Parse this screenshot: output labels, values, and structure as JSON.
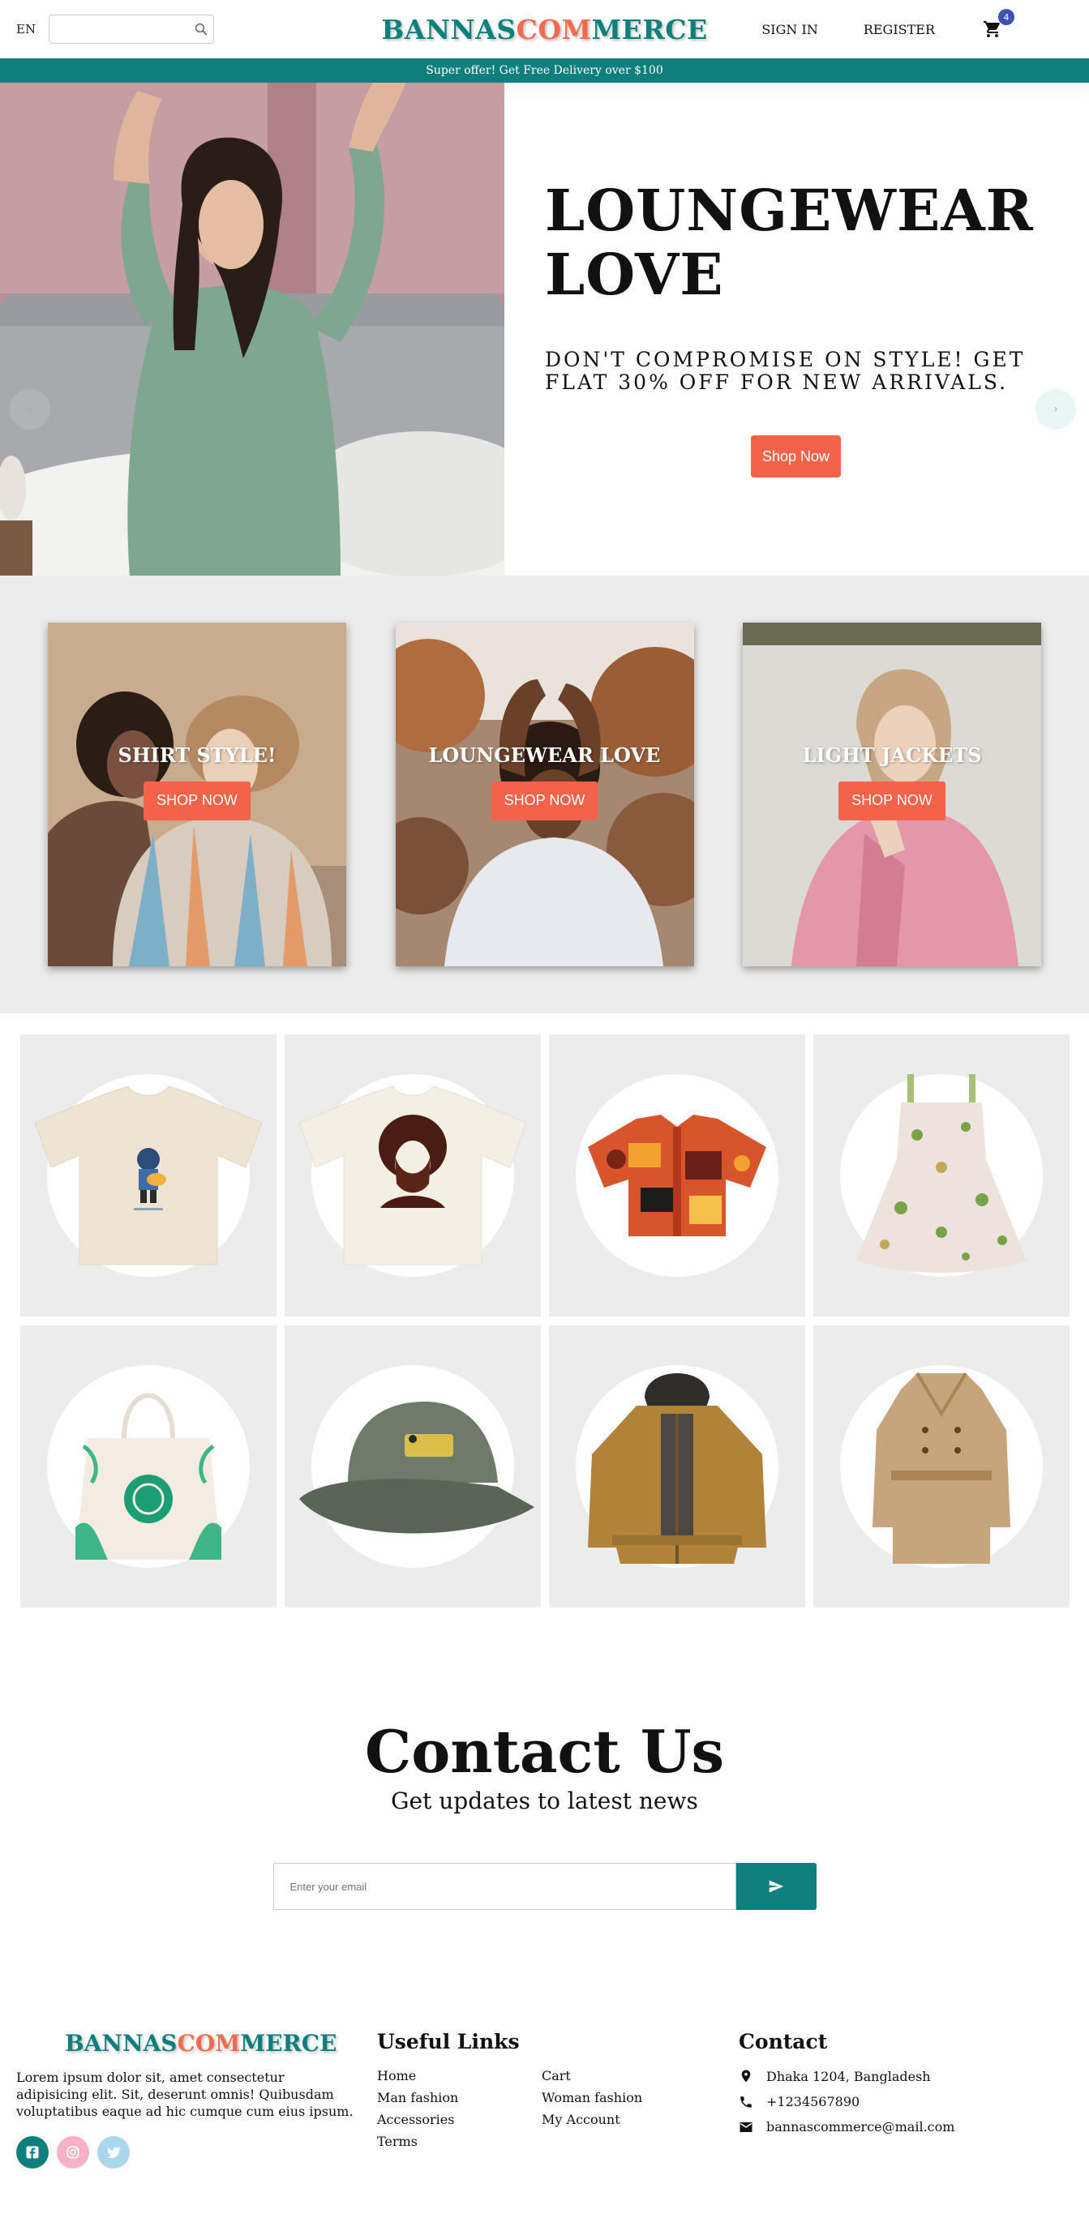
{
  "navbar": {
    "lang": "EN",
    "search_placeholder": "",
    "logo_part1": "BANNAS",
    "logo_part2": "COM",
    "logo_part3": "MERCE",
    "sign_in": "SIGN IN",
    "register": "REGISTER",
    "cart_count": "4"
  },
  "announcement": "Super offer! Get Free Delivery over $100",
  "slider": {
    "title": "LOUNGEWEAR LOVE",
    "description": "DON'T COMPROMISE ON STYLE! GET FLAT 30% OFF FOR NEW ARRIVALS.",
    "button": "Shop Now",
    "prev_arrow": "‹",
    "next_arrow": "›"
  },
  "categories": [
    {
      "title": "SHIRT STYLE!",
      "button": "SHOP NOW"
    },
    {
      "title": "LOUNGEWEAR LOVE",
      "button": "SHOP NOW"
    },
    {
      "title": "LIGHT JACKETS",
      "button": "SHOP NOW"
    }
  ],
  "products": [
    {
      "icon": "tshirt-guitar-icon"
    },
    {
      "icon": "tshirt-portrait-icon"
    },
    {
      "icon": "printed-shirt-icon"
    },
    {
      "icon": "floral-dress-icon"
    },
    {
      "icon": "tote-bag-icon"
    },
    {
      "icon": "cap-icon"
    },
    {
      "icon": "hooded-jacket-icon"
    },
    {
      "icon": "trench-coat-icon"
    }
  ],
  "contact": {
    "title": "Contact Us",
    "subtitle": "Get updates to latest news",
    "email_placeholder": "Enter your email"
  },
  "footer": {
    "logo_part1": "BANNAS",
    "logo_part2": "COM",
    "logo_part3": "MERCE",
    "description": "Lorem ipsum dolor sit, amet consectetur adipisicing elit. Sit, deserunt omnis! Quibusdam voluptatibus eaque ad hic cumque cum eius ipsum.",
    "useful_links_heading": "Useful Links",
    "links": [
      "Home",
      "Cart",
      "Man fashion",
      "Woman fashion",
      "Accessories",
      "My Account",
      "Terms"
    ],
    "contact_heading": "Contact",
    "address": "Dhaka 1204, Bangladesh",
    "phone": "+1234567890",
    "email": "bannascommerce@mail.com"
  },
  "colors": {
    "brand_teal": "#0f7f7d",
    "brand_coral": "#f36b4f",
    "button_coral": "#f4624a",
    "light_gray": "#ececec"
  }
}
